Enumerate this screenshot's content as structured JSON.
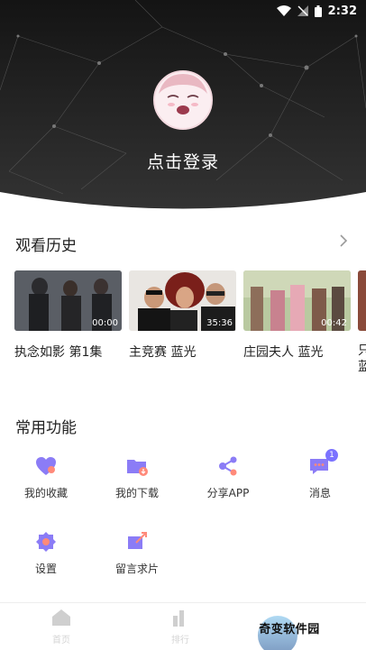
{
  "status_bar": {
    "time": "2:32",
    "icons": [
      "wifi-icon",
      "no-signal-icon",
      "battery-icon"
    ]
  },
  "profile": {
    "login_label": "点击登录",
    "avatar": "anime-avatar"
  },
  "history": {
    "title": "观看历史",
    "more_icon": "chevron-right-icon",
    "items": [
      {
        "title": "执念如影 第1集",
        "duration": "00:00"
      },
      {
        "title": "主竞赛 蓝光",
        "duration": "35:36"
      },
      {
        "title": "庄园夫人 蓝光",
        "duration": "00:42"
      },
      {
        "title": "只 蓝",
        "duration": ""
      }
    ]
  },
  "functions": {
    "title": "常用功能",
    "items": [
      {
        "label": "我的收藏",
        "icon": "heart-icon"
      },
      {
        "label": "我的下载",
        "icon": "download-folder-icon"
      },
      {
        "label": "分享APP",
        "icon": "share-icon"
      },
      {
        "label": "消息",
        "icon": "message-icon",
        "badge": "1"
      },
      {
        "label": "设置",
        "icon": "settings-icon"
      },
      {
        "label": "留言求片",
        "icon": "request-icon"
      }
    ]
  },
  "bottom_nav": {
    "items": [
      {
        "label": "首页",
        "icon": "home-icon"
      },
      {
        "label": "排行",
        "icon": "rank-icon"
      }
    ]
  },
  "watermark": {
    "text": "奇变软件园"
  },
  "colors": {
    "accent": "#7b72ff",
    "header_bg": "#1c1c1c"
  }
}
